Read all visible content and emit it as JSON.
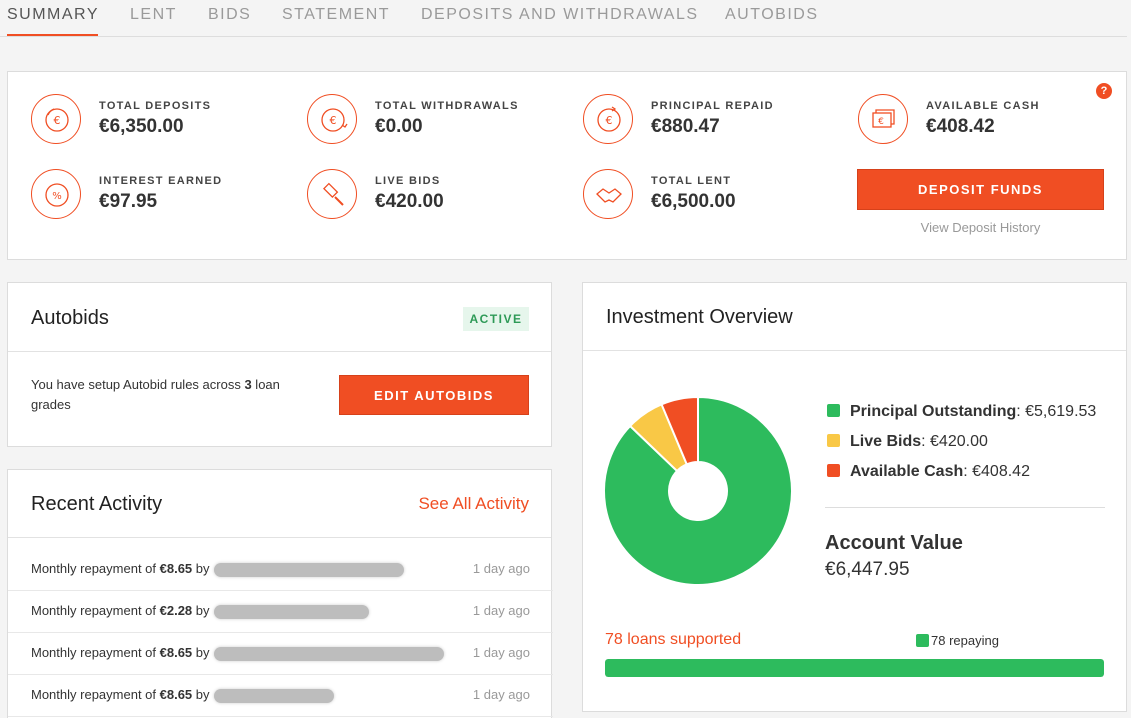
{
  "tabs": [
    {
      "label": "SUMMARY",
      "active": true
    },
    {
      "label": "LENT"
    },
    {
      "label": "BIDS"
    },
    {
      "label": "STATEMENT"
    },
    {
      "label": "DEPOSITS AND WITHDRAWALS"
    },
    {
      "label": "AUTOBIDS"
    }
  ],
  "summary": {
    "stats": [
      {
        "label": "TOTAL DEPOSITS",
        "value": "€6,350.00",
        "icon": "euro-deposit-icon"
      },
      {
        "label": "TOTAL WITHDRAWALS",
        "value": "€0.00",
        "icon": "euro-withdrawal-icon"
      },
      {
        "label": "PRINCIPAL REPAID",
        "value": "€880.47",
        "icon": "euro-repaid-icon"
      },
      {
        "label": "AVAILABLE CASH",
        "value": "€408.42",
        "icon": "cash-stack-icon"
      },
      {
        "label": "INTEREST EARNED",
        "value": "€97.95",
        "icon": "percent-icon"
      },
      {
        "label": "LIVE BIDS",
        "value": "€420.00",
        "icon": "gavel-icon"
      },
      {
        "label": "TOTAL LENT",
        "value": "€6,500.00",
        "icon": "handshake-icon"
      }
    ],
    "help_icon": "?",
    "deposit_button": "DEPOSIT FUNDS",
    "deposit_history_link": "View Deposit History"
  },
  "autobids": {
    "title": "Autobids",
    "status": "ACTIVE",
    "text_prefix": "You have setup Autobid rules across ",
    "count": "3",
    "text_suffix": " loan grades",
    "edit_button": "EDIT AUTOBIDS"
  },
  "activity": {
    "title": "Recent Activity",
    "see_all": "See All Activity",
    "rows": [
      {
        "text": "Monthly repayment of ",
        "amount": "€8.65",
        "by": " by",
        "time": "1 day ago"
      },
      {
        "text": "Monthly repayment of ",
        "amount": "€2.28",
        "by": " by",
        "time": "1 day ago"
      },
      {
        "text": "Monthly repayment of ",
        "amount": "€8.65",
        "by": " by",
        "time": "1 day ago"
      },
      {
        "text": "Monthly repayment of ",
        "amount": "€8.65",
        "by": " by",
        "time": "1 day ago"
      }
    ]
  },
  "overview": {
    "title": "Investment Overview",
    "chart_data": {
      "type": "pie",
      "donut": true,
      "categories": [
        "Principal Outstanding",
        "Live Bids",
        "Available Cash"
      ],
      "values": [
        5619.53,
        420.0,
        408.42
      ],
      "colors": [
        "#2dbb5d",
        "#f9c846",
        "#f04e23"
      ]
    },
    "legend": [
      {
        "name": "Principal Outstanding",
        "value": "€5,619.53",
        "color": "#2dbb5d"
      },
      {
        "name": "Live Bids",
        "value": "€420.00",
        "color": "#f9c846"
      },
      {
        "name": "Available Cash",
        "value": "€408.42",
        "color": "#f04e23"
      }
    ],
    "account_label": "Account Value",
    "account_value": "€6,447.95",
    "loans_supported": "78 loans supported",
    "repaying_label": "78 repaying",
    "repaying_fraction": 1.0
  },
  "colors": {
    "accent": "#f04e23",
    "green": "#2dbb5d",
    "yellow": "#f9c846"
  }
}
